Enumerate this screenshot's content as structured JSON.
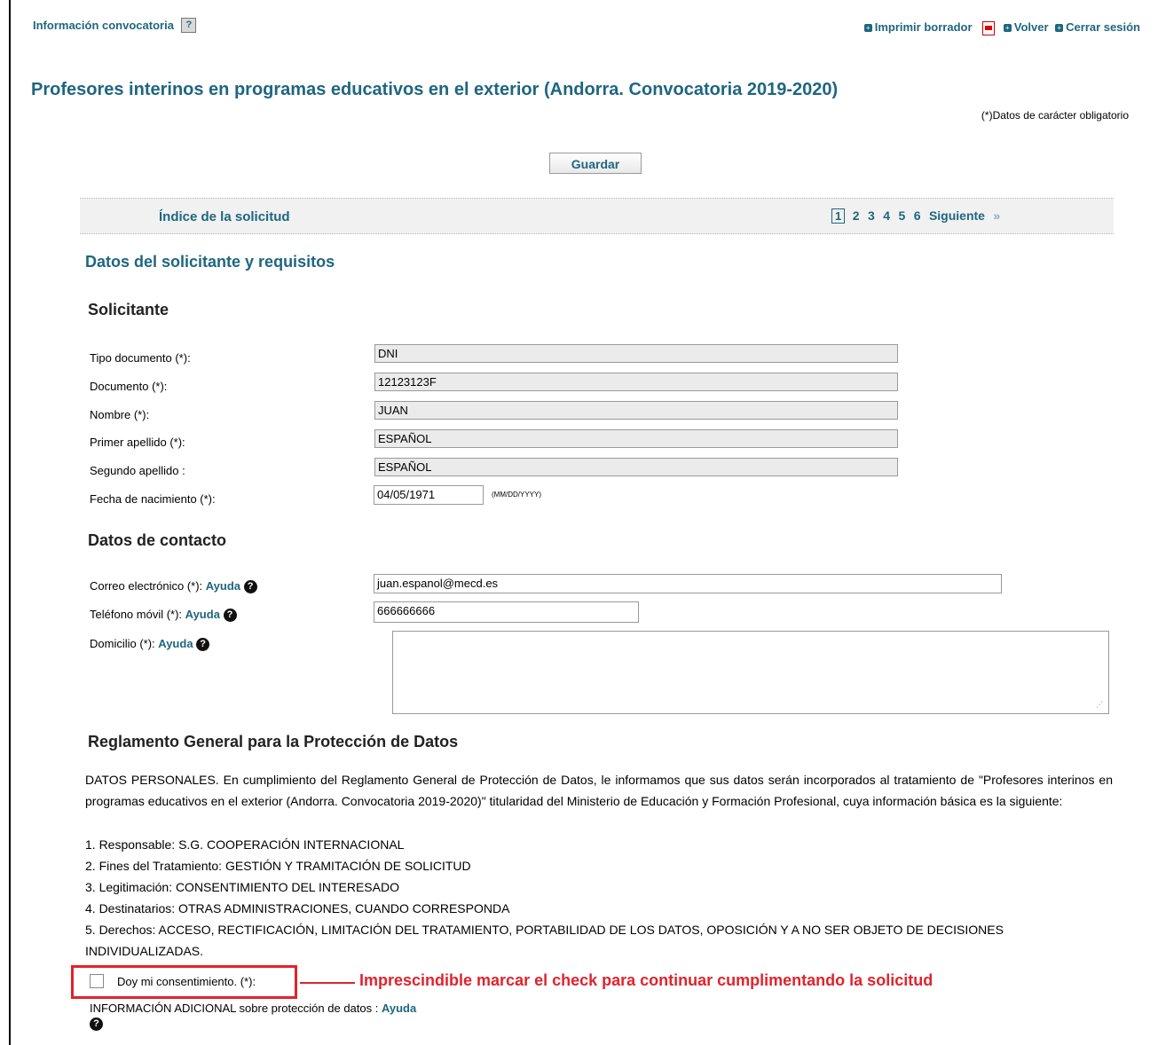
{
  "header": {
    "info_label": "Información convocatoria",
    "print_draft": "Imprimir borrador",
    "back": "Volver",
    "logout": "Cerrar sesión"
  },
  "page": {
    "title": "Profesores interinos en programas educativos en el exterior (Andorra. Convocatoria 2019-2020)",
    "mandatory_note": "(*)Datos de carácter obligatorio",
    "save_button": "Guardar"
  },
  "index_bar": {
    "label": "Índice de la solicitud",
    "current_page": "1",
    "pages": [
      "2",
      "3",
      "4",
      "5",
      "6"
    ],
    "next": "Siguiente"
  },
  "section_title": "Datos del solicitante y requisitos",
  "applicant": {
    "heading": "Solicitante",
    "fields": [
      {
        "label": "Tipo documento (*):",
        "value": "DNI"
      },
      {
        "label": "Documento (*):",
        "value": "12123123F"
      },
      {
        "label": "Nombre (*):",
        "value": "JUAN"
      },
      {
        "label": "Primer apellido (*):",
        "value": "ESPAÑOL"
      },
      {
        "label": "Segundo apellido :",
        "value": "ESPAÑOL"
      }
    ],
    "birthdate_label": "Fecha de nacimiento (*):",
    "birthdate_value": "04/05/1971",
    "birthdate_format": "(MM/DD/YYYY)"
  },
  "contact": {
    "heading": "Datos de contacto",
    "email_label": "Correo electrónico (*):",
    "email_value": "juan.espanol@mecd.es",
    "phone_label": "Teléfono móvil (*):",
    "phone_value": "666666666",
    "address_label": "Domicilio (*):",
    "address_value": "",
    "help": "Ayuda"
  },
  "gdpr": {
    "heading": "Reglamento General para la Protección de Datos",
    "intro": "DATOS PERSONALES. En cumplimiento del Reglamento General de Protección de Datos, le informamos que sus datos serán incorporados al tratamiento de \"Profesores interinos en programas educativos en el exterior (Andorra. Convocatoria 2019-2020)\" titularidad del Ministerio de Educación y Formación Profesional, cuya información básica es la siguiente:",
    "items": [
      "1. Responsable: S.G. COOPERACIÓN INTERNACIONAL",
      "2. Fines del Tratamiento: GESTIÓN Y TRAMITACIÓN DE SOLICITUD",
      "3. Legitimación: CONSENTIMIENTO DEL INTERESADO",
      "4. Destinatarios: OTRAS ADMINISTRACIONES, CUANDO CORRESPONDA",
      "5. Derechos: ACCESO, RECTIFICACIÓN, LIMITACIÓN DEL TRATAMIENTO, PORTABILIDAD DE LOS DATOS, OPOSICIÓN Y A NO SER OBJETO DE DECISIONES INDIVIDUALIZADAS."
    ],
    "consent_label": "Doy mi consentimiento. (*):",
    "annotation": "Imprescindible marcar el check para continuar cumplimentando la solicitud",
    "additional_info": "INFORMACIÓN ADICIONAL sobre protección de datos :",
    "help": "Ayuda"
  },
  "colors": {
    "accent": "#1e6680",
    "annotation_red": "#e0232c"
  },
  "icons": {
    "help_square": "question-square-icon",
    "help_circle": "question-circle-icon",
    "pdf": "pdf-icon",
    "next": "double-chevron-right-icon"
  }
}
